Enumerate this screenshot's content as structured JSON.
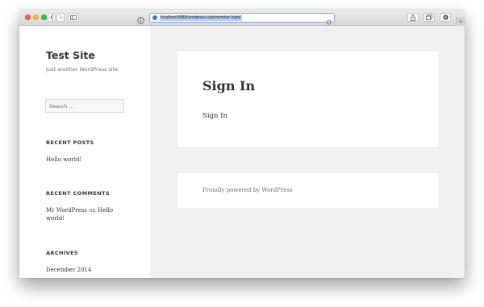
{
  "browser": {
    "url": "localhost:8888/wordpress-tuts/member-login/",
    "new_tab_label": "+"
  },
  "sidebar": {
    "site_title": "Test Site",
    "site_description": "Just another WordPress site",
    "search_placeholder": "Search …",
    "recent_posts": {
      "title": "RECENT POSTS",
      "items": [
        "Hello world!"
      ]
    },
    "recent_comments": {
      "title": "RECENT COMMENTS",
      "items": [
        {
          "author": "Mr WordPress",
          "connector": "on",
          "post": "Hello world!"
        }
      ]
    },
    "archives": {
      "title": "ARCHIVES",
      "items": [
        "December 2014"
      ]
    }
  },
  "main": {
    "page_title": "Sign In",
    "page_content": "Sign In",
    "footer_text": "Proudly powered by WordPress"
  },
  "colors": {
    "background": "#f1f1f1",
    "text": "#333333",
    "muted_text": "#707070",
    "address_focus": "#7aa9e8",
    "url_selection": "#b4d3fb"
  },
  "icons": [
    "info-icon",
    "globe-icon",
    "reload-icon",
    "share-icon",
    "tabs-overview-icon",
    "extension-icon",
    "sidebar-toggle-icon",
    "back-icon",
    "forward-icon"
  ]
}
